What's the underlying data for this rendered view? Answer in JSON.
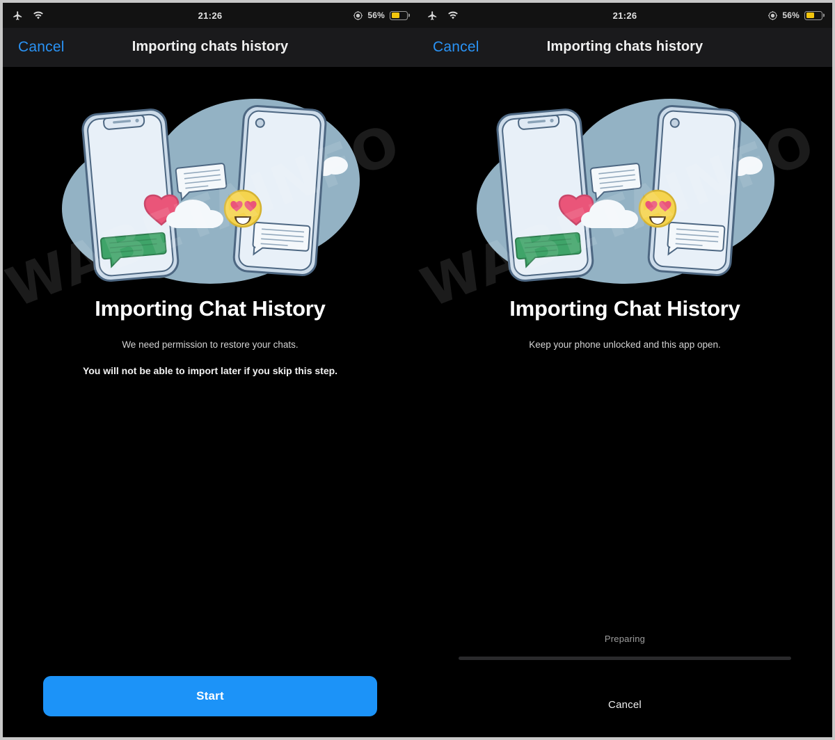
{
  "watermark": {
    "text": "WABETAINFO"
  },
  "status_bar": {
    "time": "21:26",
    "battery_percent": "56%",
    "battery_level": 56,
    "battery_color": "#f2c50d",
    "icons": {
      "left": [
        "airplane-icon",
        "wifi-icon"
      ],
      "right": [
        "location-icon",
        "battery-icon"
      ]
    }
  },
  "nav_bar": {
    "cancel_label": "Cancel",
    "title": "Importing chats history",
    "accent_color": "#2a93f5"
  },
  "illustration": {
    "name": "chat-transfer-illustration",
    "blob_color": "#93b2c4",
    "phone_color": "#dde7f2",
    "phone_stroke": "#5b7490",
    "heart_color": "#ea5579",
    "emoji_color": "#f5d44e",
    "bubble_green": "#3fa469",
    "cloud_color": "#f4f8fb"
  },
  "left_pane": {
    "headline": "Importing Chat History",
    "subtitle": "We need permission to restore your chats.",
    "warning": "You will not be able to import later if you skip this step.",
    "primary_button": "Start",
    "primary_button_color": "#1c93f8"
  },
  "right_pane": {
    "headline": "Importing Chat History",
    "subtitle": "Keep your phone unlocked and this app open.",
    "progress_label": "Preparing",
    "progress_percent": 0,
    "cancel_button": "Cancel"
  }
}
